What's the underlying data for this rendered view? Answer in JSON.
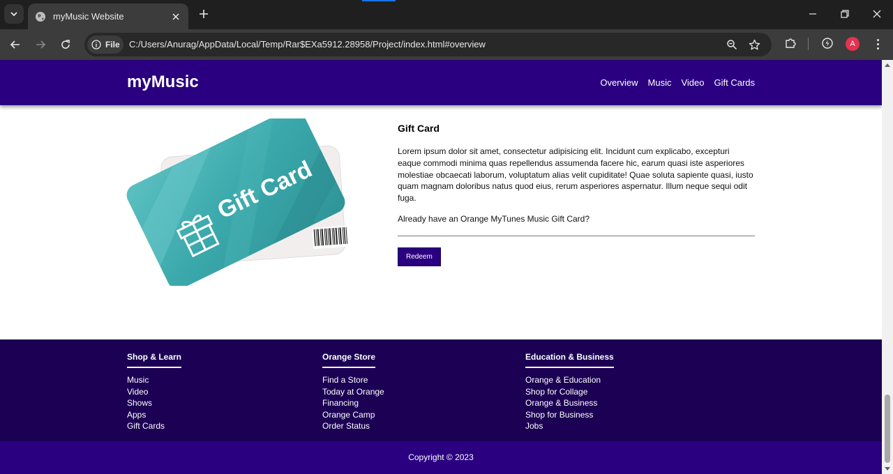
{
  "browser": {
    "tab_title": "myMusic Website",
    "file_chip": "File",
    "url": "C:/Users/Anurag/AppData/Local/Temp/Rar$EXa5912.28958/Project/index.html#overview",
    "profile_initial": "A",
    "accent": "#1a73e8"
  },
  "site": {
    "logo": "myMusic",
    "nav": [
      "Overview",
      "Music",
      "Video",
      "Gift Cards"
    ],
    "brand_color": "#2a0080"
  },
  "giftcard": {
    "image_text": "Gift Card",
    "heading": "Gift Card",
    "body": "Lorem ipsum dolor sit amet, consectetur adipisicing elit. Incidunt cum explicabo, excepturi eaque commodi minima quas repellendus assumenda facere hic, earum quasi iste asperiores molestiae obcaecati laborum, voluptatum alias velit cupiditate! Quae soluta sapiente quasi, iusto quam magnam doloribus natus quod eius, rerum asperiores aspernatur. Illum neque sequi odit fuga.",
    "question": "Already have an Orange MyTunes Music Gift Card?",
    "button": "Redeem"
  },
  "footer": {
    "columns": [
      {
        "title": "Shop & Learn",
        "links": [
          "Music",
          "Video",
          "Shows",
          "Apps",
          "Gift Cards"
        ]
      },
      {
        "title": "Orange Store",
        "links": [
          "Find a Store",
          "Today at Orange",
          "Financing",
          "Orange Camp",
          "Order Status"
        ]
      },
      {
        "title": "Education & Business",
        "links": [
          "Orange & Education",
          "Shop for Collage",
          "Orange & Business",
          "Shop for Business",
          "Jobs"
        ]
      }
    ],
    "copyright": "Copyright © 2023",
    "bg_color": "#1b0053"
  }
}
